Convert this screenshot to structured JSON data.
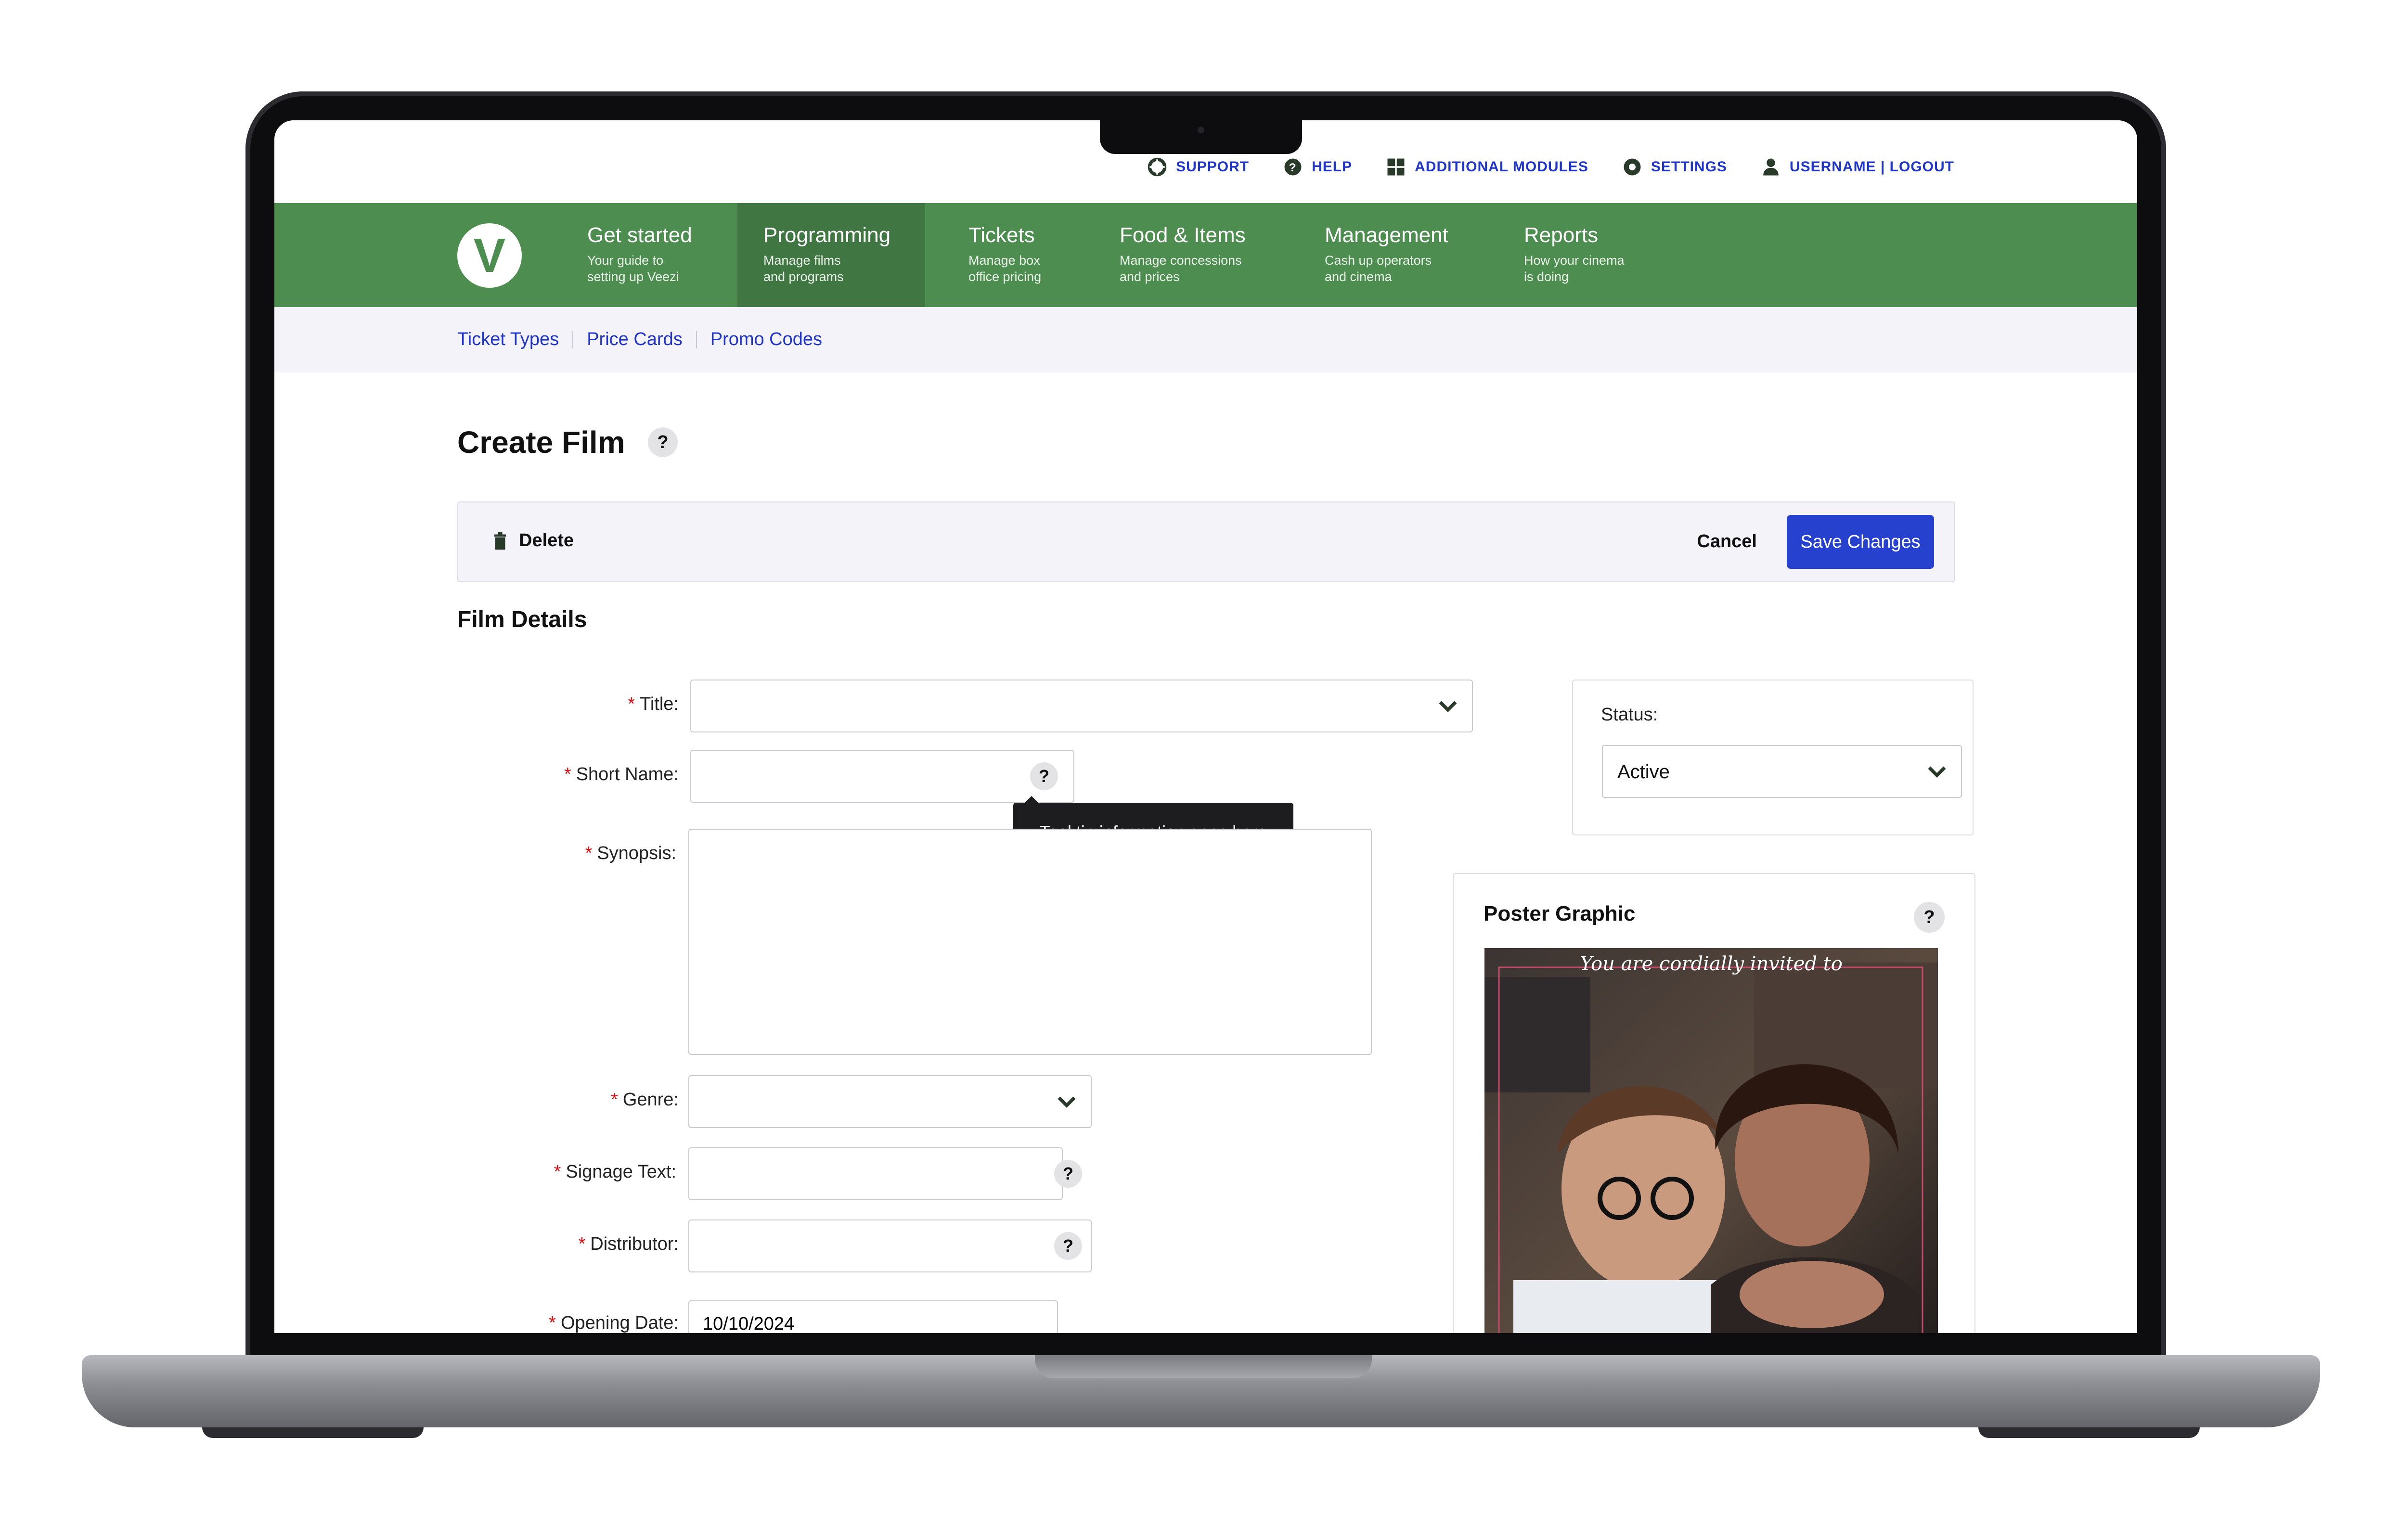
{
  "top_links": {
    "support": "SUPPORT",
    "help": "HELP",
    "additional_modules": "ADDITIONAL MODULES",
    "settings": "SETTINGS",
    "account": "USERNAME | LOGOUT"
  },
  "logo": {
    "letter": "V"
  },
  "main_nav": [
    {
      "title": "Get started",
      "subtitle": "Your guide to\nsetting up Veezi"
    },
    {
      "title": "Programming",
      "subtitle": "Manage films\nand programs"
    },
    {
      "title": "Tickets",
      "subtitle": "Manage box\noffice pricing"
    },
    {
      "title": "Food & Items",
      "subtitle": "Manage concessions\nand prices"
    },
    {
      "title": "Management",
      "subtitle": "Cash up operators\nand cinema"
    },
    {
      "title": "Reports",
      "subtitle": "How your cinema\nis doing"
    }
  ],
  "sub_nav": {
    "ticket_types": "Ticket Types",
    "price_cards": "Price Cards",
    "promo_codes": "Promo Codes"
  },
  "page": {
    "title": "Create Film",
    "help": "?"
  },
  "actions": {
    "delete": "Delete",
    "cancel": "Cancel",
    "save": "Save Changes"
  },
  "section": {
    "film_details": "Film Details"
  },
  "form": {
    "required_mark": "*",
    "title": "Title:",
    "short_name": "Short Name:",
    "synopsis": "Synopsis:",
    "genre": "Genre:",
    "signage_text": "Signage Text:",
    "distributor": "Distributor:",
    "opening_date": "Opening Date:",
    "opening_date_value": "10/10/2024",
    "help": "?"
  },
  "tooltip": {
    "text": "Tool tip information goes here"
  },
  "status": {
    "label": "Status:",
    "value": "Active"
  },
  "poster": {
    "title": "Poster Graphic",
    "caption": "You are cordially invited to",
    "help": "?"
  },
  "colors": {
    "nav_green": "#4d8d4f",
    "nav_active": "#3f7642",
    "link_blue": "#1f34c8",
    "save_blue": "#2741cf"
  }
}
